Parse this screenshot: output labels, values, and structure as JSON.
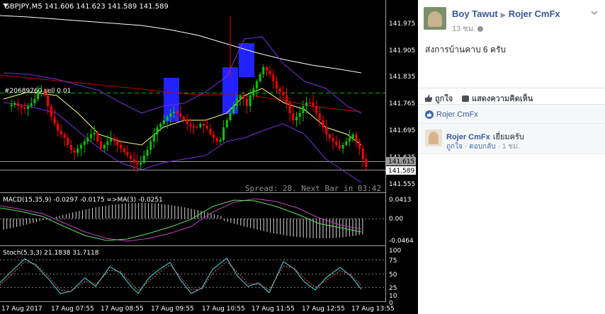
{
  "chart": {
    "symbol_header": "GBPJPY,M5  141.606 141.623 141.589 141.589",
    "trade_label": "#20689760 sell 0.01",
    "spread_text": "Spread: 28. Next Bar in 03:42",
    "price_axis": [
      "141.975",
      "141.905",
      "141.835",
      "141.765",
      "141.695",
      "141.625",
      "141.555"
    ],
    "price_box_ask": "141.615",
    "price_box_bid": "141.589",
    "macd_label": "MACD(15,35,9) -0.0297 -0.0175 =>MA(3) -0.0251",
    "macd_axis": [
      "0.0413",
      "0.00",
      "-0.0464"
    ],
    "stoch_label": "Stoch(5,3,3) 21.1838 31.7118",
    "stoch_axis": [
      "100",
      "75",
      "50",
      "25",
      "10",
      "0"
    ],
    "time_axis": [
      "17 Aug 2017",
      "17 Aug 07:55",
      "17 Aug 08:55",
      "17 Aug 09:55",
      "17 Aug 10:55",
      "17 Aug 11:55",
      "17 Aug 12:55",
      "17 Aug 13:55"
    ],
    "colors": {
      "bull": "#00c800",
      "bear": "#ff0000",
      "ma_white": "#ffffff",
      "ma_red": "#c00000",
      "bands": "#7b2ce0",
      "ma_yellow": "#ffff80",
      "stoch": "#3ec1c9",
      "box": "#2222ff",
      "trade_line": "#00b000"
    }
  },
  "post": {
    "author": "Boy Tawut",
    "target": "Rojer CmFx",
    "time": "13 ชม.",
    "text": "ส่งการบ้านคาบ 6 ครับ",
    "like_label": "ถูกใจ",
    "comment_label": "แสดงความคิดเห็น",
    "liked_by": "Rojer CmFx"
  },
  "comment": {
    "author": "Rojer CmFx",
    "text": "เยี่ยมครับ",
    "like": "ถูกใจ",
    "reply": "ตอบกลับ",
    "time": "1 ชม."
  }
}
